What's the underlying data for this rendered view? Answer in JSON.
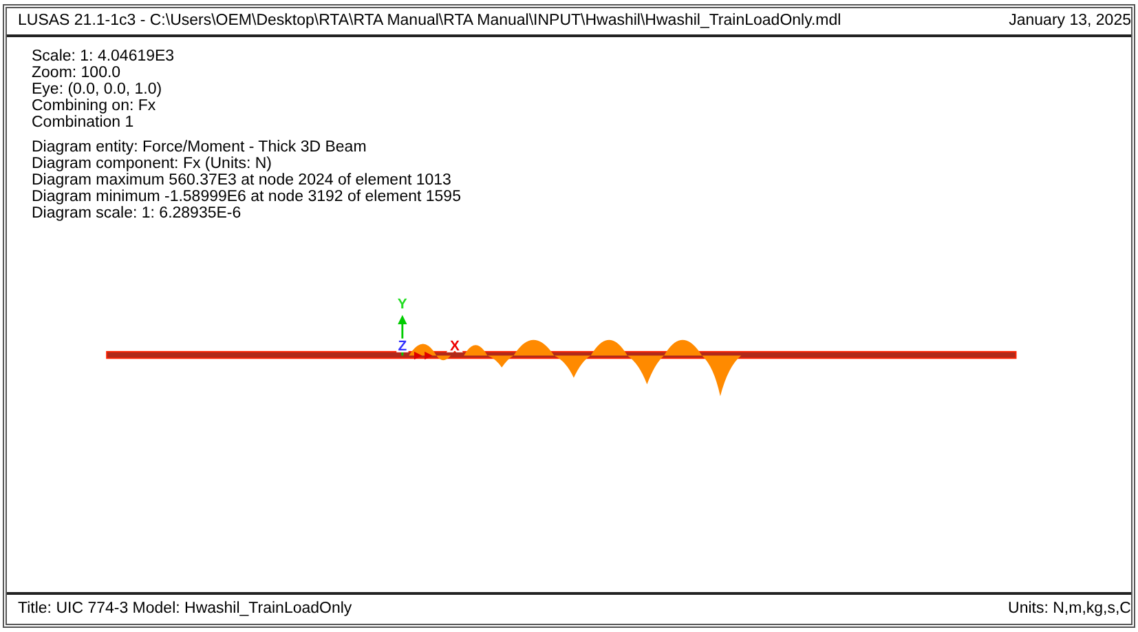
{
  "header": {
    "title": "LUSAS 21.1-1c3 - C:\\Users\\OEM\\Desktop\\RTA\\RTA Manual\\RTA Manual\\INPUT\\Hwashil\\Hwashil_TrainLoadOnly.mdl",
    "date": "January 13, 2025"
  },
  "view_info": [
    [
      "Scale: 1: 4.04619E3",
      "Zoom: 100.0",
      "Eye: (0.0, 0.0, 1.0)",
      "Combining on: Fx",
      "Combination 1"
    ],
    [
      "Diagram entity: Force/Moment - Thick 3D Beam",
      "Diagram component: Fx (Units: N)",
      "Diagram maximum 560.37E3 at node 2024 of element 1013",
      "Diagram minimum -1.58999E6 at node 3192 of element 1595",
      "Diagram scale: 1: 6.28935E-6"
    ]
  ],
  "axes": {
    "y": "Y",
    "z": "Z",
    "x": "X"
  },
  "footer": {
    "title": "Title: UIC 774-3 Model: Hwashil_TrainLoadOnly",
    "units": "Units: N,m,kg,s,C"
  }
}
